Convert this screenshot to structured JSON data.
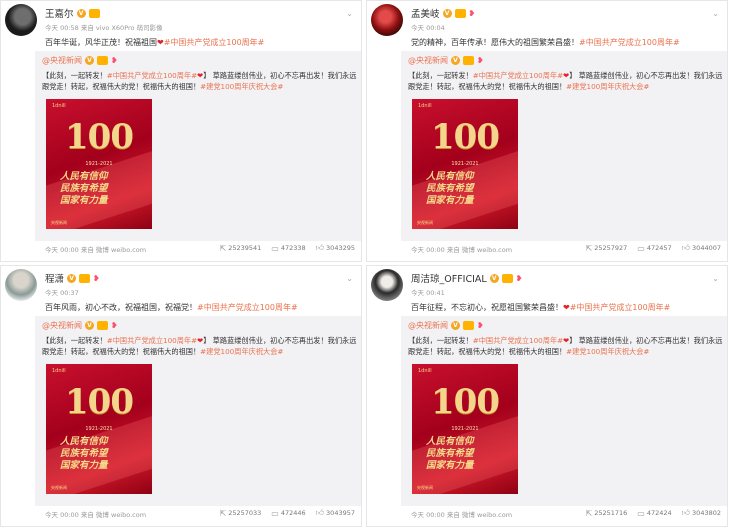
{
  "posts": [
    {
      "author": "王嘉尔",
      "meta": "今天 00:58 来自 vivo X60Pro 萌司影像",
      "text": "百年华诞，风华正茂！祝福祖国",
      "tag": "#中国共产党成立100周年#",
      "footer": "今天 00:00 来自 微博 weibo.com",
      "stats": {
        "repost": "25239541",
        "comment": "472338",
        "like": "3043295"
      }
    },
    {
      "author": "孟美岐",
      "meta": "今天 00:04",
      "text": "党的精神，百年传承！愿伟大的祖国繁荣昌盛！",
      "tag": "#中国共产党成立100周年#",
      "footer": "今天 00:00 来自 微博 weibo.com",
      "stats": {
        "repost": "25257927",
        "comment": "472457",
        "like": "3044007"
      }
    },
    {
      "author": "程潇",
      "meta": "今天 00:37",
      "text": "百年风雨，初心不改，祝福祖国，祝福党！",
      "tag": "#中国共产党成立100周年#",
      "footer": "今天 00:00 来自 微博 weibo.com",
      "stats": {
        "repost": "25257033",
        "comment": "472446",
        "like": "3043957"
      }
    },
    {
      "author": "周洁琼_OFFICIAL",
      "meta": "今天 00:41",
      "text": "百年征程，不忘初心，祝愿祖国繁荣昌盛！",
      "tag": "#中国共产党成立100周年#",
      "footer": "今天 00:00 来自 微博 weibo.com",
      "stats": {
        "repost": "25251716",
        "comment": "472424",
        "like": "3043802"
      }
    }
  ],
  "repost": {
    "author": "@央视新闻",
    "text_prefix": "【此刻，一起转发！",
    "tag1": "#中国共产党成立100周年#",
    "text_mid": "】 草路蓝缕创伟业，初心不忘再出发！我们永远跟党走！转起，祝福伟大的党！祝福伟大的祖国！",
    "tag2": "#建党100周年庆祝大会#"
  },
  "poster": {
    "small_top": "1dnill",
    "big": "100",
    "years": "1921-2021",
    "slogan_1": "人民有信仰",
    "slogan_2": "民族有希望",
    "slogan_3": "国家有力量",
    "stamp": "央视新闻"
  },
  "icons": {
    "avatar_badge": "verified-icon",
    "heart": "❤"
  }
}
